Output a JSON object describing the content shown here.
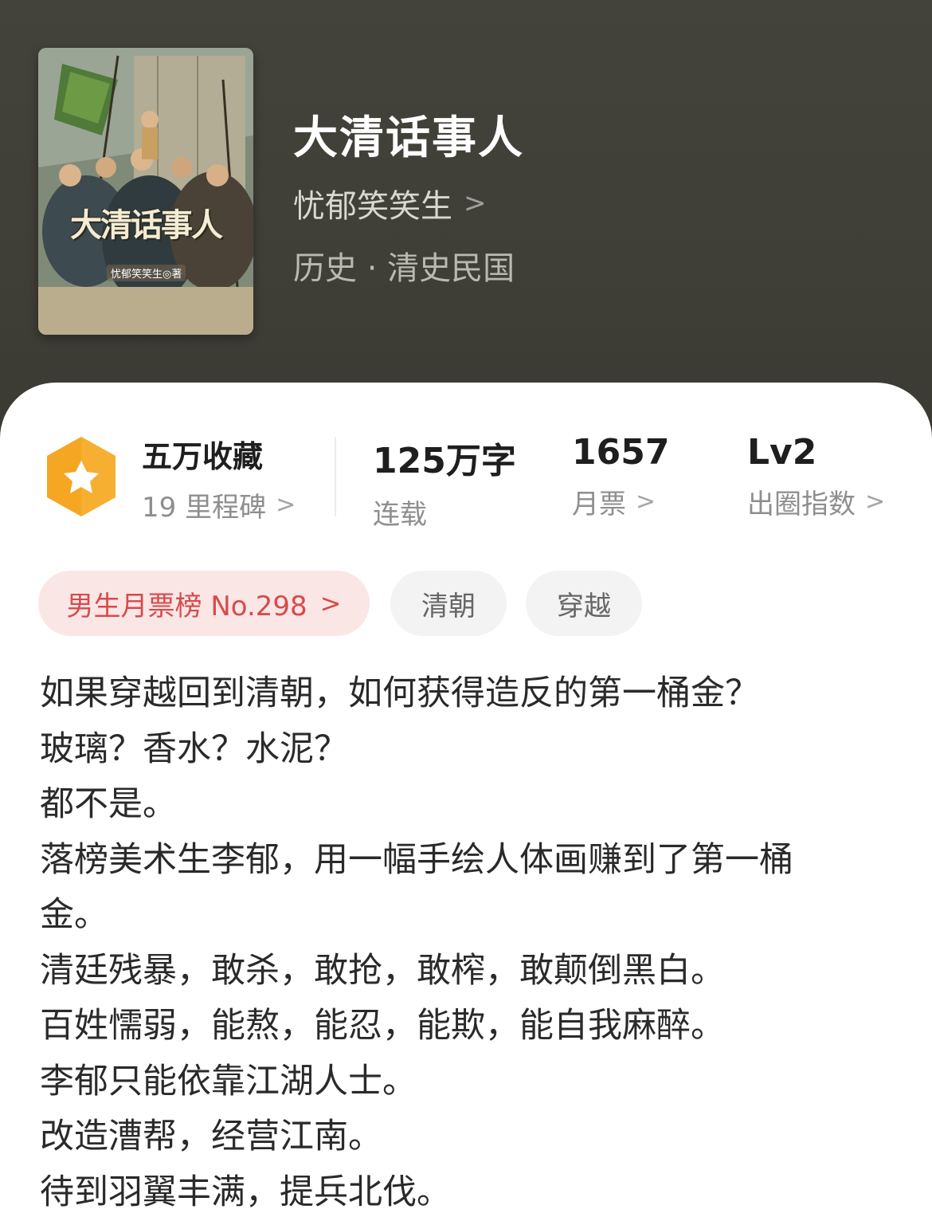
{
  "book": {
    "title": "大清话事人",
    "author": "忧郁笑笑生",
    "genre": "历史 · 清史民国",
    "cover": {
      "title_text": "大清话事人",
      "author_text": "忧郁笑笑生◎著"
    }
  },
  "stats": {
    "collection": {
      "value": "五万收藏",
      "label": "19 里程碑"
    },
    "words": {
      "value": "125万字",
      "label": "连载"
    },
    "tickets": {
      "value": "1657",
      "label": "月票"
    },
    "index": {
      "value": "Lv2",
      "label": "出圈指数"
    }
  },
  "chips": {
    "rank": "男生月票榜 No.298",
    "tags": [
      "清朝",
      "穿越"
    ]
  },
  "description": [
    "如果穿越回到清朝，如何获得造反的第一桶金？",
    "玻璃？香水？水泥？",
    "都不是。",
    "落榜美术生李郁，用一幅手绘人体画赚到了第一桶金。",
    "清廷残暴，敢杀，敢抢，敢榨，敢颠倒黑白。",
    "百姓懦弱，能熬，能忍，能欺，能自我麻醉。",
    "李郁只能依靠江湖人士。",
    "改造漕帮，经营江南。",
    "待到羽翼丰满，提兵北伐。"
  ],
  "icons": {
    "badge": "star-hexagon-icon",
    "chevron": "chevron-right-icon"
  },
  "colors": {
    "header_bg": "#3f3f37",
    "rank_chip_bg": "#fbe6e6",
    "rank_chip_text": "#d84a4a",
    "badge_orange": "#f5a623"
  }
}
